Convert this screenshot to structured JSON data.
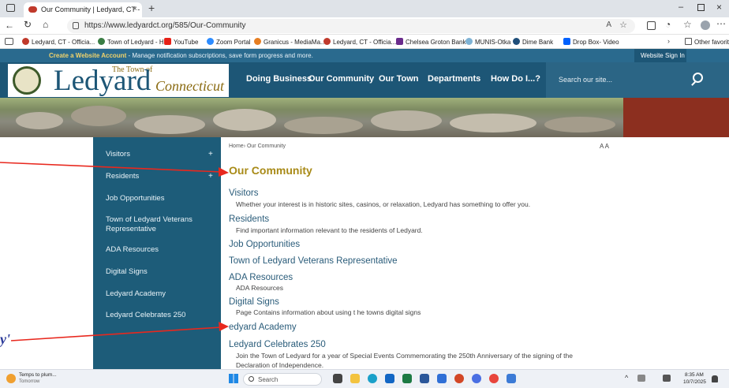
{
  "browser": {
    "tab_title": "Our Community | Ledyard, CT - C",
    "new_tab": "+",
    "url": "https://www.ledyardct.org/585/Our-Community",
    "favorites": [
      {
        "label": "Ledyard, CT - Officia...",
        "color": "#c0392b"
      },
      {
        "label": "Town of Ledyard - H...",
        "color": "#3a7d44"
      },
      {
        "label": "YouTube",
        "color": "#e62117"
      },
      {
        "label": "Zoom Portal",
        "color": "#2d8cff"
      },
      {
        "label": "Granicus - MediaMa...",
        "color": "#e67e22"
      },
      {
        "label": "Ledyard, CT - Officia...",
        "color": "#c0392b"
      },
      {
        "label": "Chelsea Groton Bank",
        "color": "#6a2c8c"
      },
      {
        "label": "MUNIS-Otka",
        "color": "#7fb3d5"
      },
      {
        "label": "Dime Bank",
        "color": "#1f4e79"
      },
      {
        "label": "Drop Box- Video",
        "color": "#0061fe"
      }
    ],
    "other_favorites": "Other favorites"
  },
  "site": {
    "notice_link": "Create a Website Account",
    "notice_text": " - Manage notification subscriptions, save form progress and more.",
    "sign_in": "Website Sign In",
    "logo_small": "The Town of",
    "logo_main": "Ledyard",
    "logo_sub": "Connecticut",
    "nav": [
      "Doing Business",
      "Our Community",
      "Our Town",
      "Departments",
      "How Do I...?"
    ],
    "search_placeholder": "Search our site...",
    "sidebar": [
      {
        "label": "Visitors",
        "plus": "+"
      },
      {
        "label": "Residents",
        "plus": "+"
      },
      {
        "label": "Job Opportunities",
        "plus": ""
      },
      {
        "label": "Town of Ledyard Veterans Representative",
        "plus": ""
      },
      {
        "label": "ADA Resources",
        "plus": ""
      },
      {
        "label": "Digital Signs",
        "plus": ""
      },
      {
        "label": "Ledyard Academy",
        "plus": ""
      },
      {
        "label": "Ledyard Celebrates 250",
        "plus": ""
      }
    ],
    "breadcrumb_home": "Home",
    "breadcrumb_current": "Our Community",
    "font_sizer": "A A",
    "page_title": "Our Community",
    "sections": [
      {
        "title": "Visitors",
        "desc": "Whether your interest is in historic sites, casinos, or relaxation, Ledyard has something to offer you."
      },
      {
        "title": "Residents",
        "desc": "Find important information relevant to the residents of Ledyard."
      },
      {
        "title": "Job Opportunities",
        "desc": ""
      },
      {
        "title": "Town of Ledyard Veterans Representative",
        "desc": ""
      },
      {
        "title": "ADA Resources",
        "desc": "ADA Resources"
      },
      {
        "title": "Digital Signs",
        "desc": "Page Contains information about using t he towns digital signs"
      },
      {
        "title": "edyard Academy",
        "desc": ""
      },
      {
        "title": "Ledyard Celebrates 250",
        "desc": "Join the Town of Ledyard for a year of Special Events Commemorating the 250th Anniversary of the signing of the",
        "desc2": "Declaration of Independence."
      }
    ]
  },
  "annotation": {
    "overlay_glyph": "y'"
  },
  "taskbar": {
    "weather_title": "Temps to plum...",
    "weather_sub": "Tomorrow",
    "search": "Search",
    "time": "8:35 AM",
    "date": "10/7/2025"
  },
  "colors": {
    "accent_red": "#e8281e",
    "title_gold": "#a88a17",
    "nav_blue": "#1d5676"
  }
}
